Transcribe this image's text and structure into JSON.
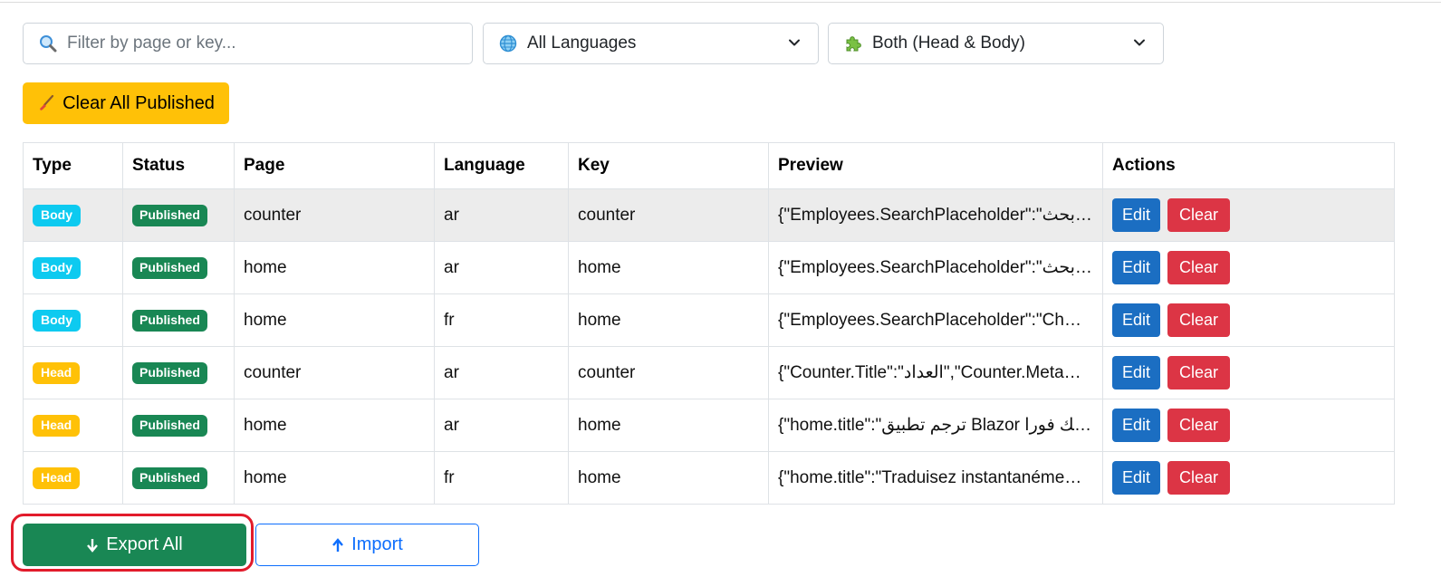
{
  "filters": {
    "search": {
      "placeholder": "Filter by page or key...",
      "icon": "search-icon"
    },
    "language": {
      "selected": "All Languages",
      "icon": "globe-icon"
    },
    "scope": {
      "selected": "Both (Head & Body)",
      "icon": "puzzle-icon"
    }
  },
  "toolbar": {
    "clear_all_label": "Clear All Published",
    "clear_all_icon": "broom-icon"
  },
  "table": {
    "headers": [
      "Type",
      "Status",
      "Page",
      "Language",
      "Key",
      "Preview",
      "Actions"
    ],
    "rows": [
      {
        "type": "Body",
        "status": "Published",
        "page": "counter",
        "language": "ar",
        "key": "counter",
        "preview": "{\"Employees.SearchPlaceholder\":\"ابحث…",
        "edit": "Edit",
        "clear": "Clear"
      },
      {
        "type": "Body",
        "status": "Published",
        "page": "home",
        "language": "ar",
        "key": "home",
        "preview": "{\"Employees.SearchPlaceholder\":\"ابحث…",
        "edit": "Edit",
        "clear": "Clear"
      },
      {
        "type": "Body",
        "status": "Published",
        "page": "home",
        "language": "fr",
        "key": "home",
        "preview": "{\"Employees.SearchPlaceholder\":\"Ch…",
        "edit": "Edit",
        "clear": "Clear"
      },
      {
        "type": "Head",
        "status": "Published",
        "page": "counter",
        "language": "ar",
        "key": "counter",
        "preview": "{\"Counter.Title\":\"العداد\",\"Counter.Meta…",
        "edit": "Edit",
        "clear": "Clear"
      },
      {
        "type": "Head",
        "status": "Published",
        "page": "home",
        "language": "ar",
        "key": "home",
        "preview": "{\"home.title\":\"ترجم تطبيق Blazor بك فورا …",
        "edit": "Edit",
        "clear": "Clear"
      },
      {
        "type": "Head",
        "status": "Published",
        "page": "home",
        "language": "fr",
        "key": "home",
        "preview": "{\"home.title\":\"Traduisez instantanéme…",
        "edit": "Edit",
        "clear": "Clear"
      }
    ]
  },
  "footer": {
    "export_label": "Export All",
    "export_icon": "arrow-down-icon",
    "import_label": "Import",
    "import_icon": "arrow-up-icon"
  },
  "colors": {
    "body_badge": "#0dcaf0",
    "head_badge": "#ffc107",
    "published_badge": "#198754",
    "edit_button": "#1b6ec2",
    "clear_button": "#dc3545",
    "export_button": "#198754",
    "import_border": "#0d6efd",
    "highlight_ring": "#e21b2b"
  }
}
